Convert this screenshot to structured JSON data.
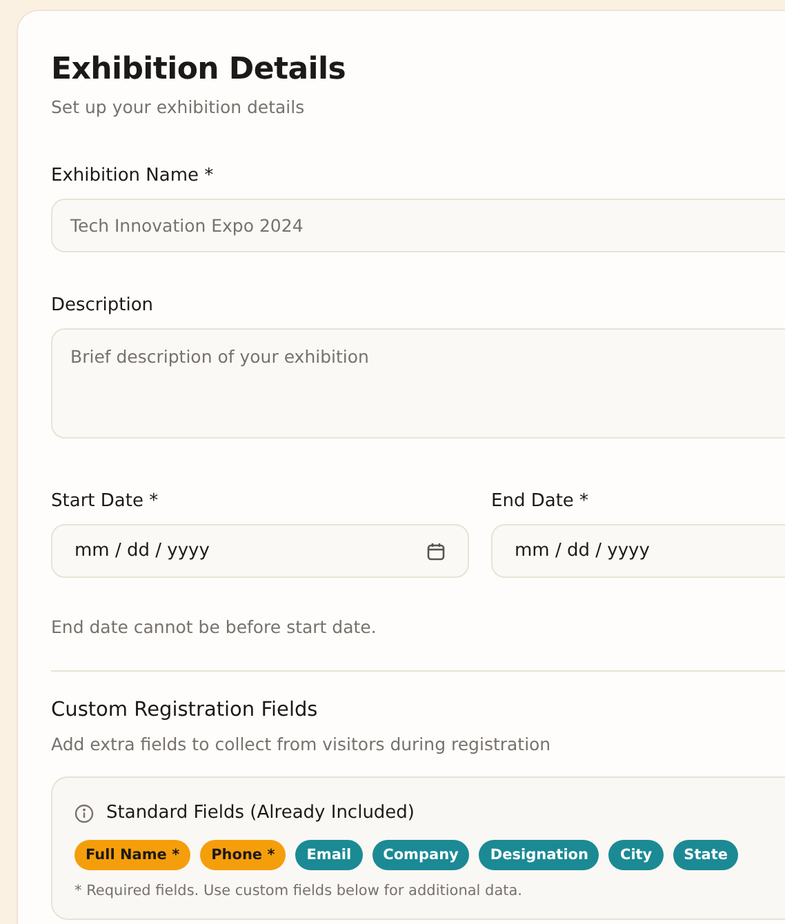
{
  "title": "Exhibition Details",
  "subtitle": "Set up your exhibition details",
  "name_field": {
    "label": "Exhibition Name *",
    "placeholder": "Tech Innovation Expo 2024"
  },
  "description_field": {
    "label": "Description",
    "placeholder": "Brief description of your exhibition"
  },
  "start_date": {
    "label": "Start Date *",
    "placeholder": "mm / dd / yyyy"
  },
  "end_date": {
    "label": "End Date *",
    "placeholder": "mm / dd / yyyy"
  },
  "date_hint": "End date cannot be before start date.",
  "custom_section": {
    "title": "Custom Registration Fields",
    "subtitle": "Add extra fields to collect from visitors during registration"
  },
  "standard_fields": {
    "title": "Standard Fields (Already Included)",
    "chips": [
      {
        "label": "Full Name *",
        "required": true
      },
      {
        "label": "Phone *",
        "required": true
      },
      {
        "label": "Email",
        "required": false
      },
      {
        "label": "Company",
        "required": false
      },
      {
        "label": "Designation",
        "required": false
      },
      {
        "label": "City",
        "required": false
      },
      {
        "label": "State",
        "required": false
      }
    ],
    "note": "* Required fields. Use custom fields below for additional data."
  }
}
